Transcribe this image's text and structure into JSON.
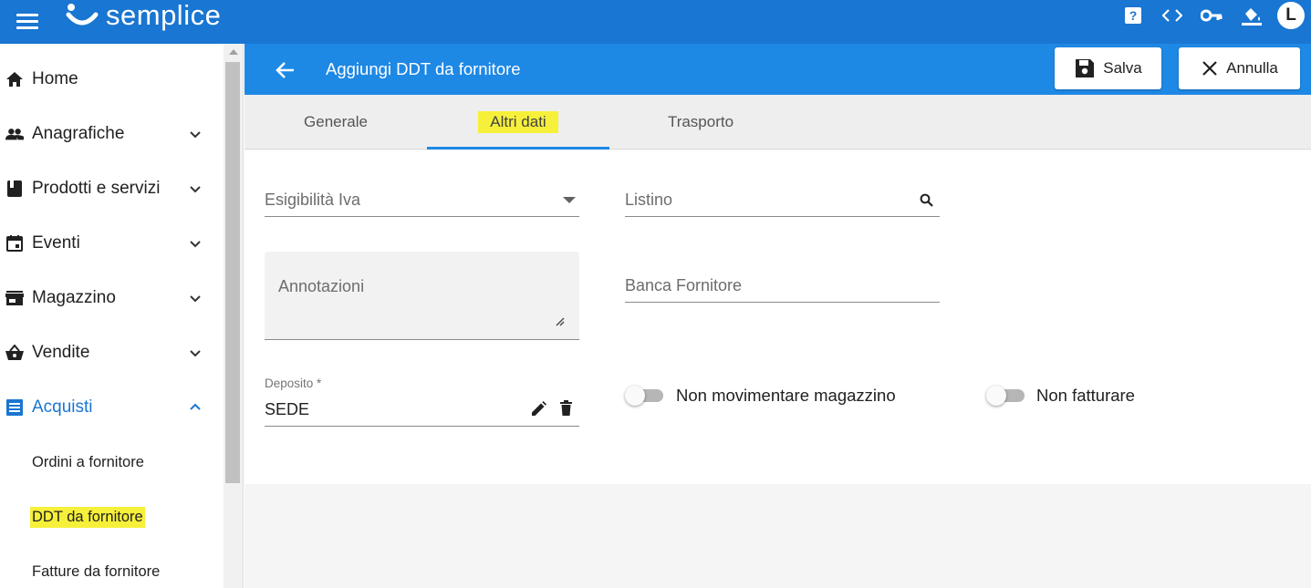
{
  "appbar": {
    "brand": "semplice",
    "avatar_letter": "L",
    "icons": [
      "menu-icon",
      "help-icon",
      "code-icon",
      "key-icon",
      "paint-bucket-icon"
    ]
  },
  "sidebar": {
    "items": [
      {
        "label": "Home",
        "icon": "home-icon"
      },
      {
        "label": "Anagrafiche",
        "icon": "people-icon"
      },
      {
        "label": "Prodotti e servizi",
        "icon": "book-icon"
      },
      {
        "label": "Eventi",
        "icon": "calendar-icon"
      },
      {
        "label": "Magazzino",
        "icon": "store-icon"
      },
      {
        "label": "Vendite",
        "icon": "basket-icon"
      },
      {
        "label": "Acquisti",
        "icon": "list-icon"
      }
    ],
    "subitems": [
      {
        "label": "Ordini a fornitore"
      },
      {
        "label": "DDT da fornitore"
      },
      {
        "label": "Fatture da fornitore"
      }
    ]
  },
  "header": {
    "title": "Aggiungi DDT da fornitore",
    "save_label": "Salva",
    "cancel_label": "Annulla"
  },
  "tabs": [
    {
      "label": "Generale"
    },
    {
      "label": "Altri dati"
    },
    {
      "label": "Trasporto"
    }
  ],
  "form": {
    "esigibilita_label": "Esigibilità Iva",
    "listino_label": "Listino",
    "annotazioni_label": "Annotazioni",
    "banca_label": "Banca Fornitore",
    "deposito_label": "Deposito *",
    "deposito_value": "SEDE",
    "toggle_magazzino_label": "Non movimentare magazzino",
    "toggle_fatturare_label": "Non fatturare"
  },
  "colors": {
    "appbar": "#1976d2",
    "header": "#1e88e5",
    "active": "#1976d2",
    "highlight": "#f6f03a"
  }
}
